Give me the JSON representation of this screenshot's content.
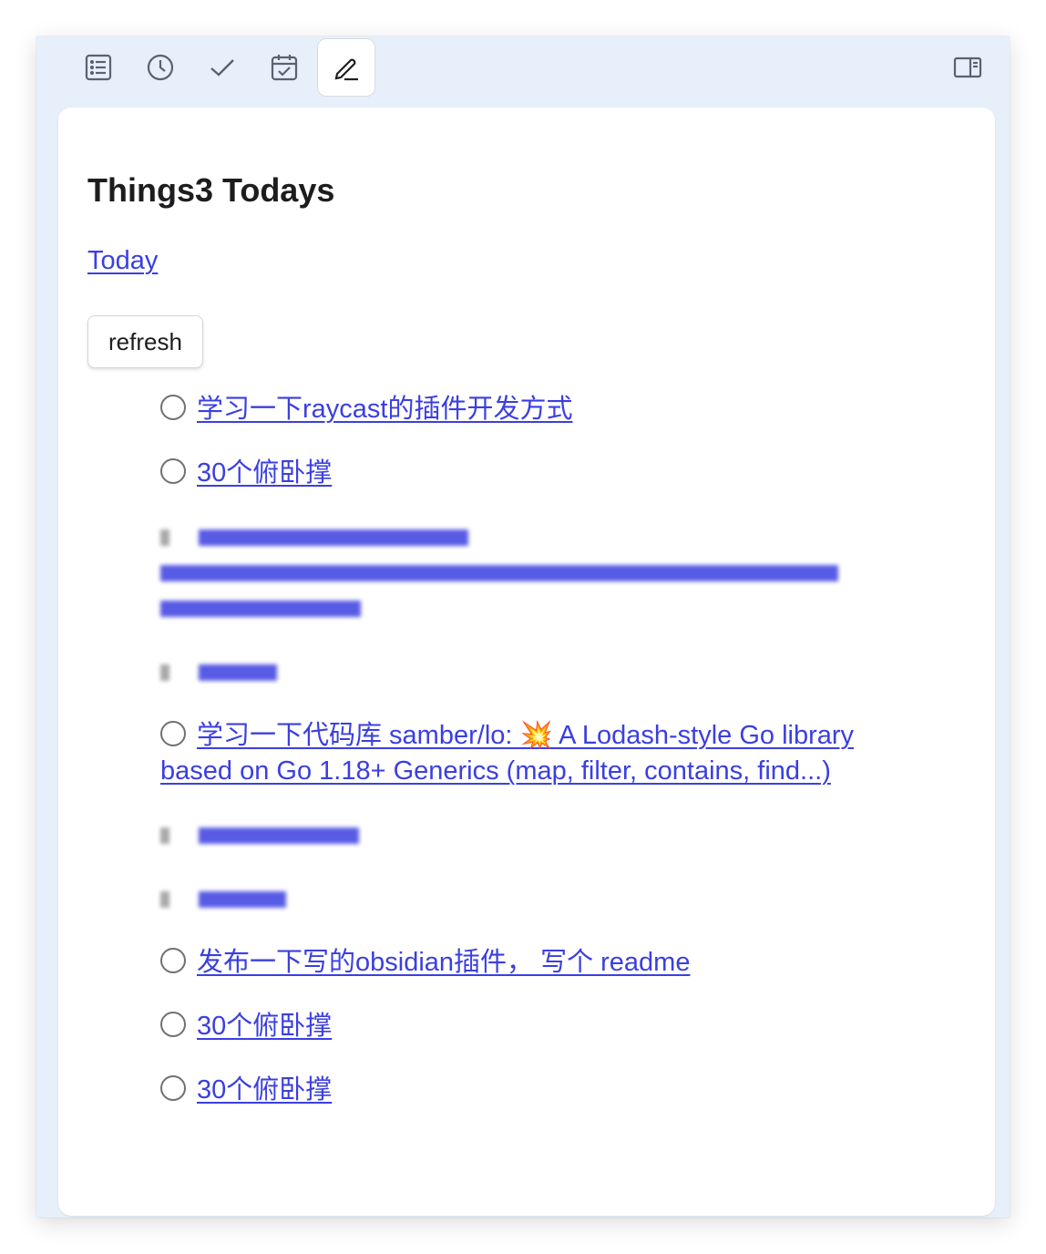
{
  "toolbar": {
    "icons": [
      "list-icon",
      "clock-icon",
      "checkmark-icon",
      "calendar-check-icon",
      "pencil-icon",
      "sidebar-toggle-icon"
    ],
    "active": "pencil-icon"
  },
  "page": {
    "title": "Things3 Todays",
    "today_link": "Today",
    "refresh_label": "refresh"
  },
  "tasks": [
    {
      "text": "学习一下raycast的插件开发方式",
      "checkbox": true
    },
    {
      "text": "30个俯卧撑",
      "checkbox": true
    },
    {
      "text": "",
      "checkbox": true,
      "redacted": true
    },
    {
      "text": "",
      "checkbox": true,
      "redacted": true
    },
    {
      "text": "学习一下代码库 samber/lo: 💥 A Lodash-style Go library based on Go 1.18+ Generics (map, filter, contains, find...)",
      "checkbox": true
    },
    {
      "text": "",
      "checkbox": true,
      "redacted": true
    },
    {
      "text": "",
      "checkbox": true,
      "redacted": true
    },
    {
      "text": "发布一下写的obsidian插件， 写个 readme",
      "checkbox": true
    },
    {
      "text": "30个俯卧撑",
      "checkbox": true
    },
    {
      "text": "30个俯卧撑",
      "checkbox": true
    }
  ],
  "colors": {
    "link": "#3b3fe0",
    "window_bg": "#e6effa",
    "panel_bg": "#ffffff"
  }
}
